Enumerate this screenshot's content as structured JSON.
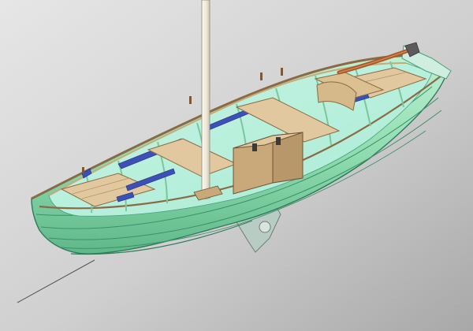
{
  "scene": {
    "subject": "",
    "colors": {
      "background_light": "#e6e6e6",
      "background_dark": "#a8a8a8",
      "hull_light": "#bff0d2",
      "hull_mid": "#8fdcb0",
      "hull_dark": "#5fb889",
      "hull_edge": "#2f7a58",
      "interior": "#a9ecd6",
      "wood_light": "#e2c89e",
      "wood_mid": "#c9a97a",
      "wood_dark": "#8a6a44",
      "tiller": "#a8582a",
      "blue_parts": "#3d4fb8",
      "mast": "#ece7d6",
      "mast_edge": "#8e8a7c",
      "rudder": "#b9ccc4",
      "line": "#555555"
    }
  }
}
